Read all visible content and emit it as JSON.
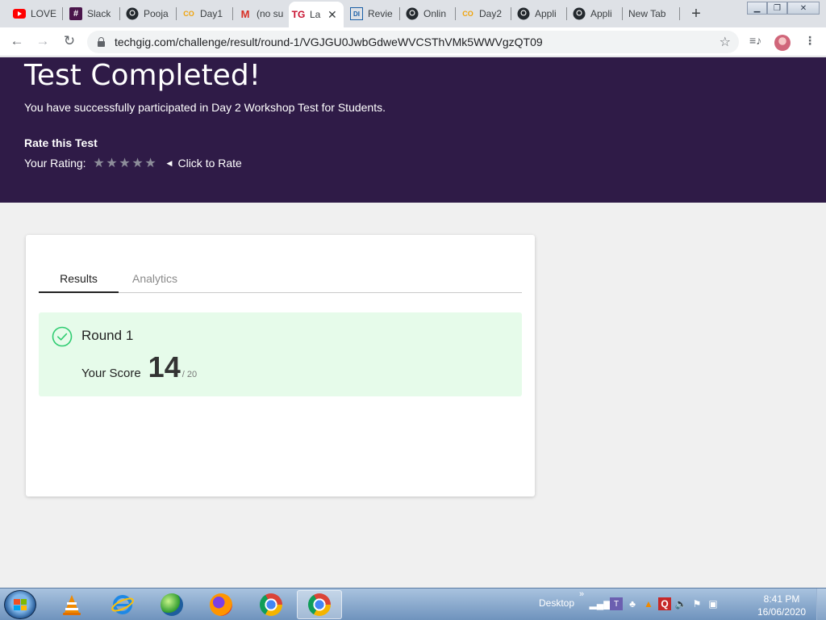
{
  "browser": {
    "tabs": [
      {
        "title": "LOVE",
        "icon": "youtube-icon"
      },
      {
        "title": "Slack",
        "icon": "slack-icon"
      },
      {
        "title": "Pooja",
        "icon": "github-icon"
      },
      {
        "title": "Day1",
        "icon": "codechef-icon"
      },
      {
        "title": "(no su",
        "icon": "gmail-icon"
      },
      {
        "title": "La",
        "icon": "techgig-icon",
        "active": true
      },
      {
        "title": "Revie",
        "icon": "review-icon"
      },
      {
        "title": "Onlin",
        "icon": "github-icon"
      },
      {
        "title": "Day2",
        "icon": "codechef-icon"
      },
      {
        "title": "Appli",
        "icon": "github-icon"
      },
      {
        "title": "Appli",
        "icon": "github-icon"
      },
      {
        "title": "New Tab",
        "icon": "blank-icon"
      }
    ],
    "favicon_text": {
      "slack": "#",
      "codechef": "CO",
      "gmail": "M",
      "techgig": "TG",
      "review": "DI"
    },
    "url": "techgig.com/challenge/result/round-1/VGJGU0JwbGdweWVCSThVMk5WWVgzQT09"
  },
  "banner": {
    "title": "Test Completed!",
    "subtitle": "You have successfully participated in Day 2 Workshop Test for Students.",
    "rate_title": "Rate this Test",
    "rating_label": "Your Rating:",
    "rating_stars": 5,
    "click_to_rate": "Click to Rate",
    "bg_color": "#2f1b47"
  },
  "card": {
    "tabs": [
      {
        "label": "Results",
        "active": true
      },
      {
        "label": "Analytics",
        "active": false
      }
    ],
    "result": {
      "round": "Round 1",
      "score_label": "Your Score",
      "score": "14",
      "score_max": "/ 20",
      "status_color": "#2ecc71",
      "bg_color": "#e6fbea"
    }
  },
  "taskbar": {
    "apps": [
      "vlc-icon",
      "internet-explorer-icon",
      "media-player-icon",
      "firefox-icon",
      "chrome-icon",
      "chrome-icon"
    ],
    "desktop_label": "Desktop",
    "time": "8:41 PM",
    "date": "16/06/2020"
  }
}
